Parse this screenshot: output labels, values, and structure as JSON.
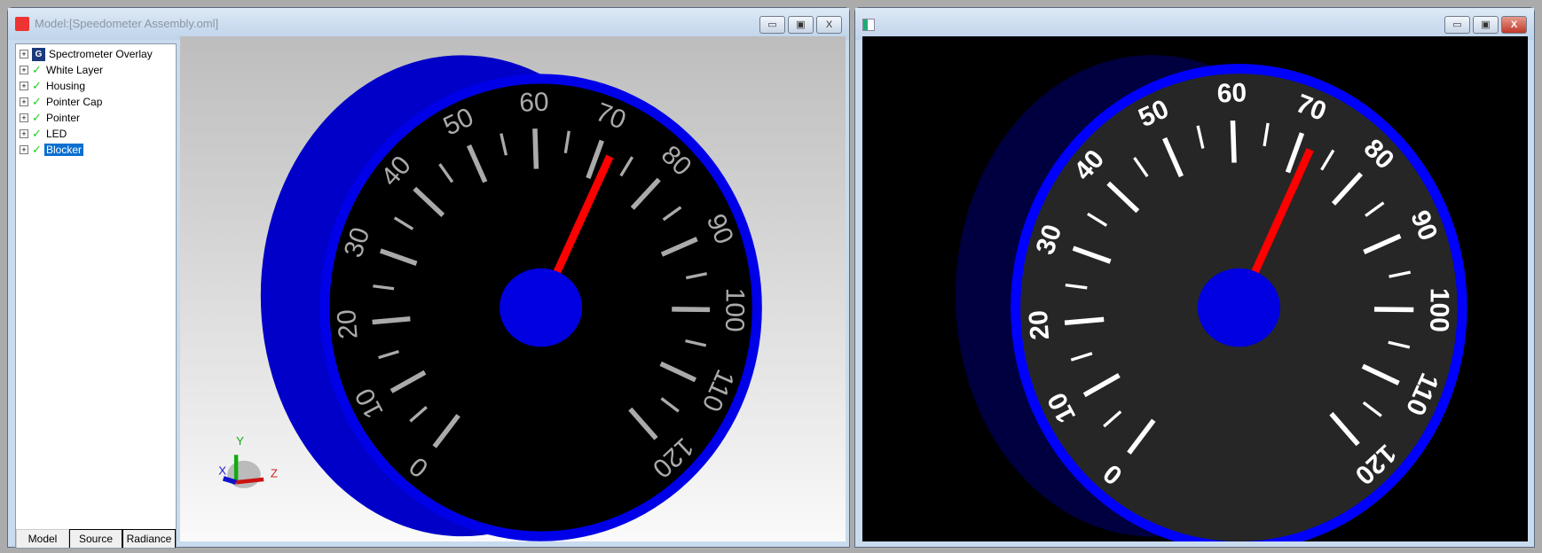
{
  "left_window": {
    "title": "Model:[Speedometer Assembly.oml]",
    "tree": [
      {
        "label": "Spectrometer Overlay",
        "icon": "group-icon"
      },
      {
        "label": "White Layer",
        "icon": "check-icon"
      },
      {
        "label": "Housing",
        "icon": "check-icon"
      },
      {
        "label": "Pointer Cap",
        "icon": "check-icon"
      },
      {
        "label": "Pointer",
        "icon": "check-icon"
      },
      {
        "label": "LED",
        "icon": "check-icon"
      },
      {
        "label": "Blocker",
        "icon": "check-icon",
        "selected": true
      }
    ],
    "tabs": [
      "Model",
      "Source",
      "Radiance"
    ],
    "axes": {
      "x": "X",
      "y": "Y",
      "z": "Z"
    }
  },
  "right_window": {
    "title": ""
  },
  "window_buttons": {
    "minimize": "▭",
    "maximize": "▣",
    "close": "X"
  },
  "dial": {
    "labels": [
      "0",
      "10",
      "20",
      "30",
      "40",
      "50",
      "60",
      "70",
      "80",
      "90",
      "100",
      "110",
      "120"
    ],
    "pointer_value": 72
  },
  "colors": {
    "housing": "#0000e0",
    "pointer": "#ff0000",
    "face": "#000000",
    "selection": "#0a6fd0"
  }
}
